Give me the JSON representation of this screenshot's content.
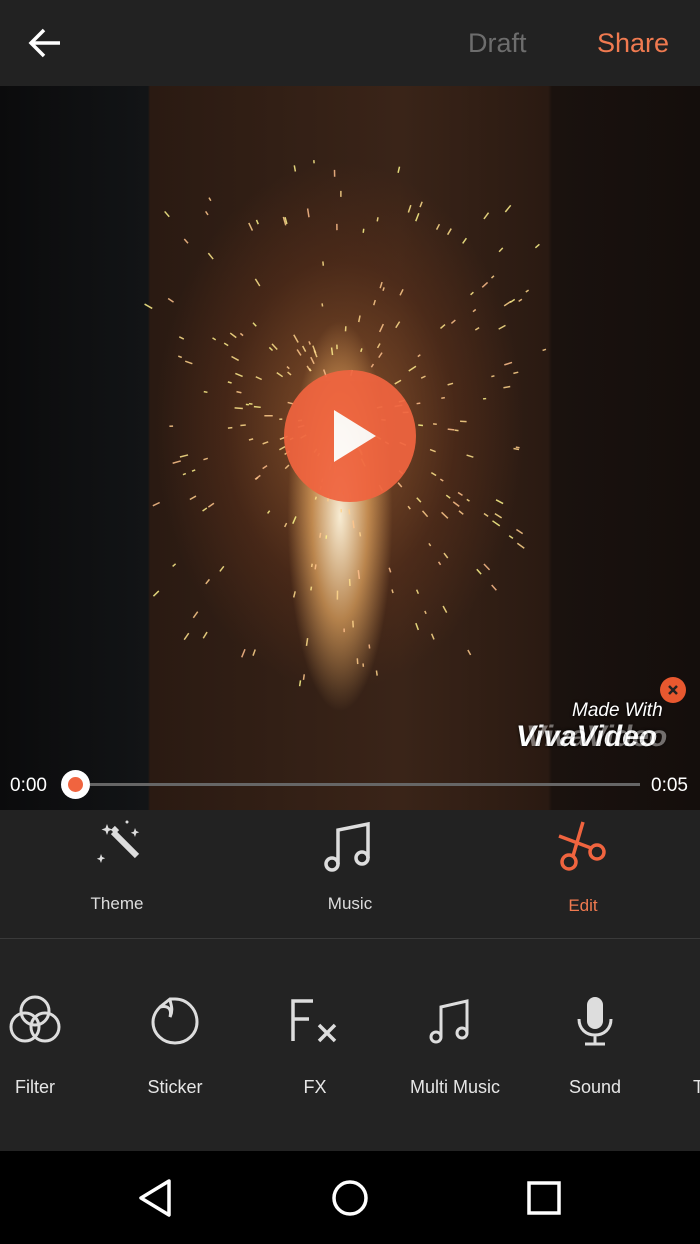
{
  "header": {
    "back_icon": "arrow-left-icon",
    "draft_label": "Draft",
    "share_label": "Share"
  },
  "colors": {
    "accent": "#f07a50",
    "background": "#222222"
  },
  "player": {
    "watermark_line1": "Made With",
    "watermark_line2": "VivaVideo",
    "current_time": "0:00",
    "duration": "0:05",
    "progress": 0
  },
  "tabs": [
    {
      "label": "Theme",
      "icon": "magic-wand-icon"
    },
    {
      "label": "Music",
      "icon": "music-note-icon"
    },
    {
      "label": "Edit",
      "icon": "scissors-icon",
      "active": true
    }
  ],
  "tools": [
    {
      "label": "Filter",
      "icon": "filter-circles-icon"
    },
    {
      "label": "Sticker",
      "icon": "sticker-icon"
    },
    {
      "label": "FX",
      "icon": "fx-icon"
    },
    {
      "label": "Multi Music",
      "icon": "music-note-icon"
    },
    {
      "label": "Sound",
      "icon": "microphone-icon"
    },
    {
      "label": "T",
      "icon": "text-icon"
    }
  ],
  "navbar": {
    "back": "triangle-back-icon",
    "home": "circle-home-icon",
    "recents": "square-recents-icon"
  }
}
